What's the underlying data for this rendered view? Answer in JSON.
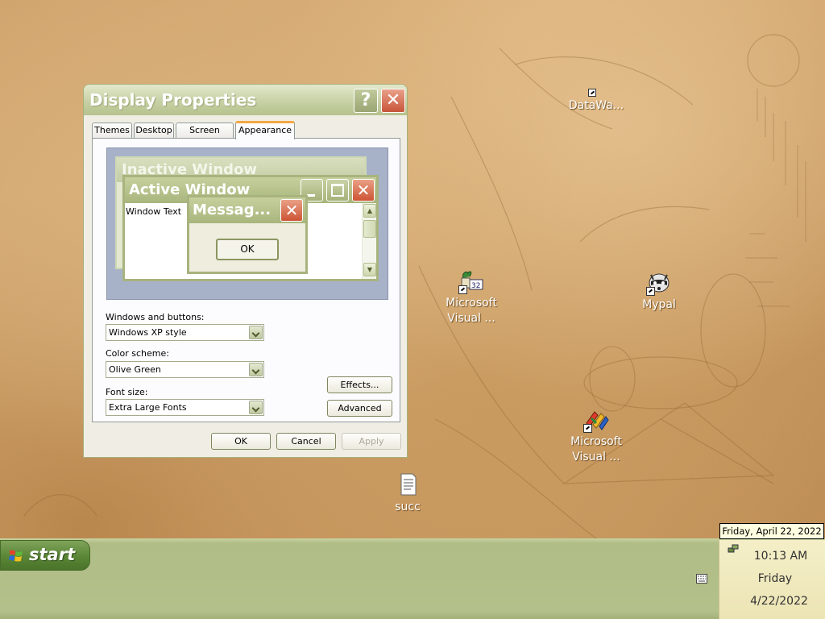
{
  "desktop": {
    "icons": [
      {
        "label": "DataWa...",
        "icon": "datawarehouse-icon"
      },
      {
        "label1": "Microsoft",
        "label2": "Visual ...",
        "icon": "visual-basic-32-icon"
      },
      {
        "label": "Mypal",
        "icon": "mypal-raccoon-icon"
      },
      {
        "label1": "Microsoft",
        "label2": "Visual ...",
        "icon": "visual-studio-icon"
      },
      {
        "label": "succ",
        "icon": "text-document-icon"
      }
    ]
  },
  "dialog": {
    "title": "Display Properties",
    "help_glyph": "?",
    "close_glyph": "✕",
    "tabs": [
      "Themes",
      "Desktop",
      "Screen Saver",
      "Appearance"
    ],
    "active_tab": "Appearance",
    "preview": {
      "inactive_title": "Inactive Window",
      "active_title": "Active Window",
      "window_text": "Window Text",
      "message_title": "Messag...",
      "message_ok": "OK"
    },
    "windows_buttons_label": "Windows and buttons:",
    "windows_buttons_value": "Windows XP style",
    "color_scheme_label": "Color scheme:",
    "color_scheme_value": "Olive Green",
    "font_size_label": "Font size:",
    "font_size_value": "Extra Large Fonts",
    "effects_button": "Effects...",
    "advanced_button": "Advanced",
    "ok_button": "OK",
    "cancel_button": "Cancel",
    "apply_button": "Apply"
  },
  "taskbar": {
    "start_label": "start",
    "tooltip": "Friday, April 22, 2022",
    "time": "10:13 AM",
    "day": "Friday",
    "date": "4/22/2022"
  },
  "colors": {
    "theme": "#b3c08b",
    "start_button": "#5a8636",
    "tab_highlight": "#f3a842"
  }
}
